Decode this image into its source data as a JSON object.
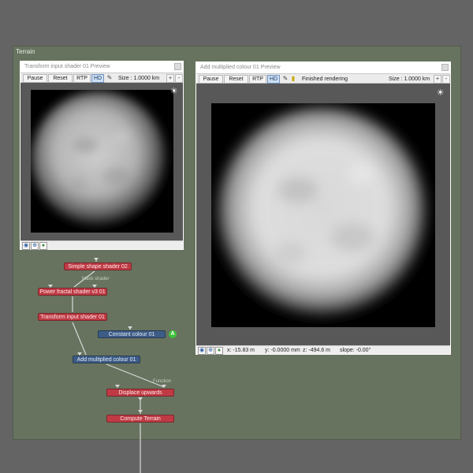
{
  "panel": {
    "title": "Terrain"
  },
  "preview_left": {
    "title": "Transform input shader 01 Preview",
    "toolbar": {
      "pause": "Pause",
      "reset": "Reset",
      "rtp": "RTP",
      "hd": "HD",
      "size": "Size : 1.0000 km",
      "plus": "+",
      "minus": "-"
    }
  },
  "preview_right": {
    "title": "Add multiplied colour 01 Preview",
    "toolbar": {
      "pause": "Pause",
      "reset": "Reset",
      "rtp": "RTP",
      "hd": "HD",
      "status": "Finished rendering",
      "size": "Size : 1.0000 km",
      "plus": "+",
      "minus": "-"
    },
    "statusbar": {
      "x": "x: -15.83 m",
      "y": "y: -0.0000 mm",
      "z": "z: -494.6 m",
      "slope": "slope: -0.00°"
    }
  },
  "nodes": {
    "simple_shape": "Simple shape shader 02",
    "mask_label": "Mask shader",
    "power_fractal": "Power fractal shader v3 01",
    "transform_input": "Transform input shader 01",
    "constant_colour": "Constant colour 01",
    "constant_badge": "A",
    "add_multiplied": "Add multiplied colour 01",
    "function_label": "Function",
    "displace_upwards": "Displace upwards",
    "compute_terrain": "Compute Terrain"
  },
  "icons": {
    "sun": "sun-icon",
    "pick": "color-picker-icon",
    "eye": "eye-icon",
    "crosshair": "crosshair-icon",
    "globe": "globe-icon"
  },
  "colors": {
    "panel": "#67735e",
    "node_red": "#bf3a44",
    "node_blue": "#3d5c86",
    "badge_green": "#3cc23a"
  }
}
